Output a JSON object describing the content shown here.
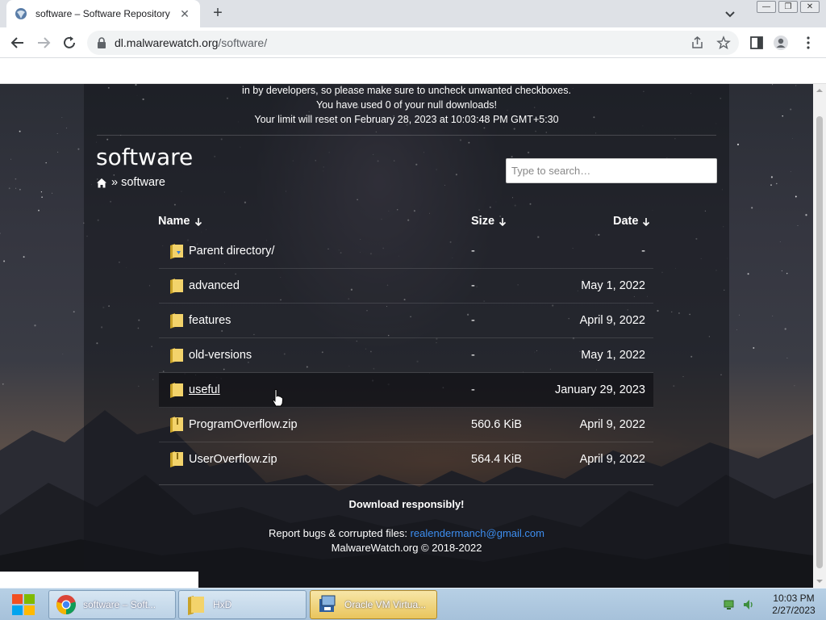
{
  "browser": {
    "tab_title": "software – Software Repository",
    "tab_close": "✕",
    "new_tab": "+",
    "url_host": "dl.malwarewatch.org",
    "url_path": "/software/",
    "window_buttons": [
      "—",
      "❐",
      "✕"
    ]
  },
  "notice": {
    "line1": "in by developers, so please make sure to uncheck unwanted checkboxes.",
    "line2": "You have used 0 of your null downloads!",
    "line3": "Your limit will reset on February 28, 2023 at 10:03:48 PM GMT+5:30"
  },
  "page": {
    "title": "software",
    "breadcrumb_sep": "»",
    "breadcrumb_current": "software",
    "search_placeholder": "Type to search…"
  },
  "table": {
    "headers": {
      "name": "Name",
      "size": "Size",
      "date": "Date"
    },
    "rows": [
      {
        "icon": "parent-folder-icon",
        "name": "Parent directory/",
        "size": "-",
        "date": "-"
      },
      {
        "icon": "folder-icon",
        "name": "advanced",
        "size": "-",
        "date": "May 1, 2022"
      },
      {
        "icon": "folder-icon",
        "name": "features",
        "size": "-",
        "date": "April 9, 2022"
      },
      {
        "icon": "folder-icon",
        "name": "old-versions",
        "size": "-",
        "date": "May 1, 2022"
      },
      {
        "icon": "folder-icon",
        "name": "useful",
        "size": "-",
        "date": "January 29, 2023"
      },
      {
        "icon": "file-icon",
        "name": "ProgramOverflow.zip",
        "size": "560.6 KiB",
        "date": "April 9, 2022"
      },
      {
        "icon": "file-icon",
        "name": "UserOverflow.zip",
        "size": "564.4 KiB",
        "date": "April 9, 2022"
      }
    ]
  },
  "footer": {
    "tagline": "Download responsibly!",
    "report_label": "Report bugs & corrupted files: ",
    "report_email": "realendermanch@gmail.com",
    "copyright": "MalwareWatch.org © 2018-2022"
  },
  "taskbar": {
    "tasks": [
      {
        "label": "software – Soft...",
        "icon": "chrome-icon"
      },
      {
        "label": "HxD",
        "icon": "folder-icon"
      },
      {
        "label": "Oracle VM Virtua...",
        "icon": "virtualbox-icon"
      }
    ],
    "clock_time": "10:03 PM",
    "clock_date": "2/27/2023"
  },
  "colors": {
    "link": "#3d8ef0",
    "taskbar": "#a6c1da",
    "active_task": "#e9c55c"
  }
}
